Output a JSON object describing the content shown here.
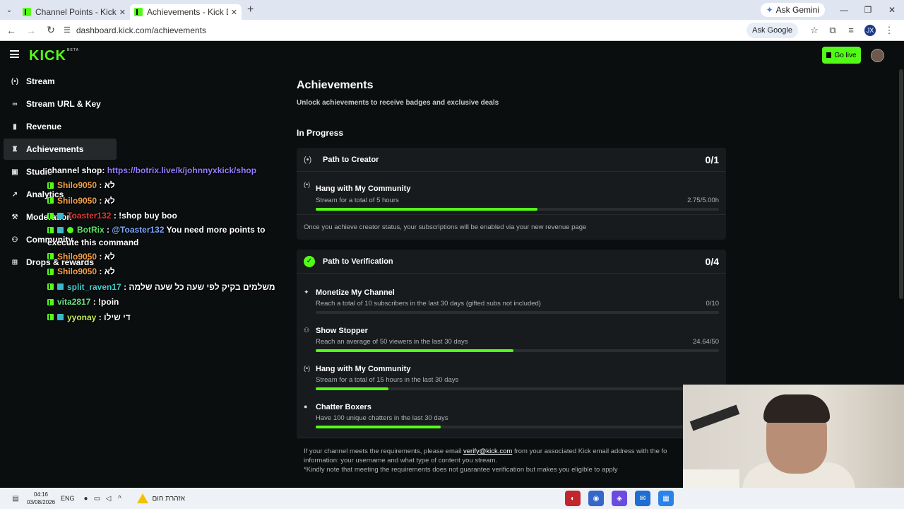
{
  "browser": {
    "tabs": [
      {
        "title": "Channel Points - Kick Dashboa"
      },
      {
        "title": "Achievements - Kick Dashboard"
      }
    ],
    "ask_gemini": "Ask Gemini",
    "url": "dashboard.kick.com/achievements",
    "ask_google": "Ask Google",
    "profile_initial": "JX"
  },
  "header": {
    "logo": "KICK",
    "logo_badge": "BETA",
    "go_live": "Go live"
  },
  "sidebar": {
    "items": [
      {
        "label": "Stream",
        "icon": "broadcast-icon"
      },
      {
        "label": "Stream URL & Key",
        "icon": "link-icon"
      },
      {
        "label": "Revenue",
        "icon": "revenue-icon"
      },
      {
        "label": "Achievements",
        "icon": "trophy-icon"
      },
      {
        "label": "Studio",
        "icon": "studio-icon"
      },
      {
        "label": "Analytics",
        "icon": "analytics-icon"
      },
      {
        "label": "Moderation",
        "icon": "wrench-icon"
      },
      {
        "label": "Community",
        "icon": "community-icon"
      },
      {
        "label": "Drops & rewards",
        "icon": "gift-icon"
      }
    ]
  },
  "chat": {
    "shop_label": "channel shop:",
    "shop_link": "https://botrix.live/k/johnnyxkick/shop",
    "messages": [
      {
        "user": "Shilo9050",
        "text": ": לא"
      },
      {
        "user": "Shilo9050",
        "text": ": לא"
      },
      {
        "user": "Toaster132",
        "text": ": !shop buy boo"
      },
      {
        "user": "BotRix",
        "mention": "@Toaster132",
        "text": "You need more points to execute this command"
      },
      {
        "user": "Shilo9050",
        "text": ": לא"
      },
      {
        "user": "Shilo9050",
        "text": ": לא"
      },
      {
        "user": "split_raven17",
        "text": ": משלמים בקיק לפי שעה כל שעה שלמה"
      },
      {
        "user": "vita2817",
        "text": ": !poin"
      },
      {
        "user": "yyonay",
        "text": ": די שילו"
      }
    ]
  },
  "main": {
    "title": "Achievements",
    "subtitle": "Unlock achievements to receive badges and exclusive deals",
    "section": "In Progress",
    "creator": {
      "title": "Path to Creator",
      "count": "0/1",
      "items": [
        {
          "title": "Hang with My Community",
          "desc": "Stream for a total of 5 hours",
          "value": "2.75/5.00h",
          "progress": 0.55
        }
      ],
      "footer": "Once you achieve creator status, your subscriptions will be enabled via your new revenue page"
    },
    "verification": {
      "title": "Path to Verification",
      "count": "0/4",
      "items": [
        {
          "title": "Monetize My Channel",
          "desc": "Reach a total of 10 subscribers in the last 30 days (gifted subs not included)",
          "value": "0/10",
          "progress": 0
        },
        {
          "title": "Show Stopper",
          "desc": "Reach an average of 50 viewers in the last 30 days",
          "value": "24.64/50",
          "progress": 0.49
        },
        {
          "title": "Hang with My Community",
          "desc": "Stream for a total of 15 hours in the last 30 days",
          "value": "",
          "progress": 0.18
        },
        {
          "title": "Chatter Boxers",
          "desc": "Have 100 unique chatters in the last 30 days",
          "value": "",
          "progress": 0.31
        }
      ]
    },
    "note_prefix": "If your channel meets the requirements, please email",
    "note_email": "verify@kick.com",
    "note_suffix": "from your associated Kick email address with the fo",
    "note_line2": "information: your username and what type of content you stream.",
    "note_line3": "*Kindly note that meeting the requirements does not guarantee verification but makes you eligible to apply"
  },
  "taskbar": {
    "time": "04:16",
    "date": "03/08/2026",
    "lang": "ENG",
    "warning": "אזהרת חום"
  },
  "colors": {
    "accent": "#53fc18",
    "background": "#0b0e0f",
    "card": "#181b1d"
  }
}
